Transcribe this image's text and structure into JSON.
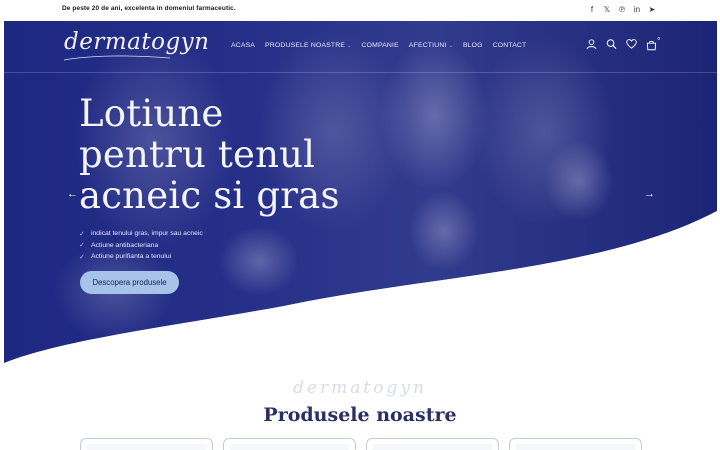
{
  "topbar": {
    "tagline": "De peste 20 de ani, excelenta in domeniul farmaceutic.",
    "socials": [
      {
        "icon": "facebook-icon",
        "glyph": "f"
      },
      {
        "icon": "x-icon",
        "glyph": "𝕏"
      },
      {
        "icon": "pinterest-icon",
        "glyph": "℗"
      },
      {
        "icon": "linkedin-icon",
        "glyph": "in"
      },
      {
        "icon": "telegram-icon",
        "glyph": "➤"
      }
    ]
  },
  "header": {
    "logo": "dermatogyn",
    "nav": [
      {
        "label": "ACASA",
        "dropdown": false
      },
      {
        "label": "PRODUSELE NOASTRE",
        "dropdown": true
      },
      {
        "label": "COMPANIE",
        "dropdown": false
      },
      {
        "label": "AFECTIUNI",
        "dropdown": true
      },
      {
        "label": "BLOG",
        "dropdown": false
      },
      {
        "label": "CONTACT",
        "dropdown": false
      }
    ],
    "icons": [
      "account-icon",
      "search-icon",
      "wishlist-heart-icon",
      "cart-bag-icon"
    ],
    "cart_count": "0"
  },
  "hero": {
    "title": "Lotiune pentru tenul acneic si gras",
    "features": [
      "indicat tenului gras, impur sau acneic",
      "Actiune antibacteriana",
      "Actiune purifianta a tenului"
    ],
    "cta": "Descopera produsele",
    "prev_arrow": "←",
    "next_arrow": "→"
  },
  "products": {
    "watermark": "dermatogyn",
    "title": "Produsele noastre",
    "cards": [
      {},
      {},
      {},
      {}
    ]
  },
  "colors": {
    "hero_navy": "#1b2478",
    "cta_blue": "#a7c3ea",
    "title_navy": "#2a2f63"
  }
}
